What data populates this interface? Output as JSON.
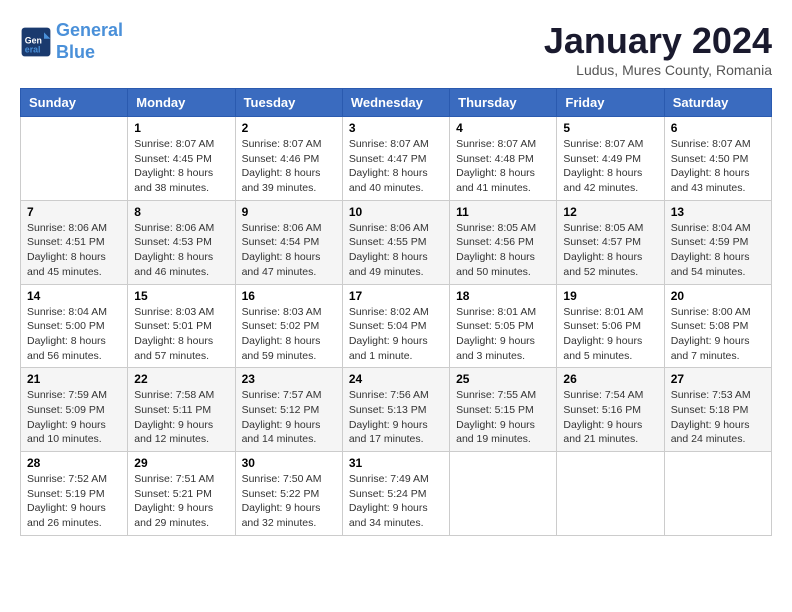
{
  "header": {
    "logo_line1": "General",
    "logo_line2": "Blue",
    "month_title": "January 2024",
    "subtitle": "Ludus, Mures County, Romania"
  },
  "days_of_week": [
    "Sunday",
    "Monday",
    "Tuesday",
    "Wednesday",
    "Thursday",
    "Friday",
    "Saturday"
  ],
  "weeks": [
    [
      {
        "day": "",
        "info": ""
      },
      {
        "day": "1",
        "info": "Sunrise: 8:07 AM\nSunset: 4:45 PM\nDaylight: 8 hours\nand 38 minutes."
      },
      {
        "day": "2",
        "info": "Sunrise: 8:07 AM\nSunset: 4:46 PM\nDaylight: 8 hours\nand 39 minutes."
      },
      {
        "day": "3",
        "info": "Sunrise: 8:07 AM\nSunset: 4:47 PM\nDaylight: 8 hours\nand 40 minutes."
      },
      {
        "day": "4",
        "info": "Sunrise: 8:07 AM\nSunset: 4:48 PM\nDaylight: 8 hours\nand 41 minutes."
      },
      {
        "day": "5",
        "info": "Sunrise: 8:07 AM\nSunset: 4:49 PM\nDaylight: 8 hours\nand 42 minutes."
      },
      {
        "day": "6",
        "info": "Sunrise: 8:07 AM\nSunset: 4:50 PM\nDaylight: 8 hours\nand 43 minutes."
      }
    ],
    [
      {
        "day": "7",
        "info": "Sunrise: 8:06 AM\nSunset: 4:51 PM\nDaylight: 8 hours\nand 45 minutes."
      },
      {
        "day": "8",
        "info": "Sunrise: 8:06 AM\nSunset: 4:53 PM\nDaylight: 8 hours\nand 46 minutes."
      },
      {
        "day": "9",
        "info": "Sunrise: 8:06 AM\nSunset: 4:54 PM\nDaylight: 8 hours\nand 47 minutes."
      },
      {
        "day": "10",
        "info": "Sunrise: 8:06 AM\nSunset: 4:55 PM\nDaylight: 8 hours\nand 49 minutes."
      },
      {
        "day": "11",
        "info": "Sunrise: 8:05 AM\nSunset: 4:56 PM\nDaylight: 8 hours\nand 50 minutes."
      },
      {
        "day": "12",
        "info": "Sunrise: 8:05 AM\nSunset: 4:57 PM\nDaylight: 8 hours\nand 52 minutes."
      },
      {
        "day": "13",
        "info": "Sunrise: 8:04 AM\nSunset: 4:59 PM\nDaylight: 8 hours\nand 54 minutes."
      }
    ],
    [
      {
        "day": "14",
        "info": "Sunrise: 8:04 AM\nSunset: 5:00 PM\nDaylight: 8 hours\nand 56 minutes."
      },
      {
        "day": "15",
        "info": "Sunrise: 8:03 AM\nSunset: 5:01 PM\nDaylight: 8 hours\nand 57 minutes."
      },
      {
        "day": "16",
        "info": "Sunrise: 8:03 AM\nSunset: 5:02 PM\nDaylight: 8 hours\nand 59 minutes."
      },
      {
        "day": "17",
        "info": "Sunrise: 8:02 AM\nSunset: 5:04 PM\nDaylight: 9 hours\nand 1 minute."
      },
      {
        "day": "18",
        "info": "Sunrise: 8:01 AM\nSunset: 5:05 PM\nDaylight: 9 hours\nand 3 minutes."
      },
      {
        "day": "19",
        "info": "Sunrise: 8:01 AM\nSunset: 5:06 PM\nDaylight: 9 hours\nand 5 minutes."
      },
      {
        "day": "20",
        "info": "Sunrise: 8:00 AM\nSunset: 5:08 PM\nDaylight: 9 hours\nand 7 minutes."
      }
    ],
    [
      {
        "day": "21",
        "info": "Sunrise: 7:59 AM\nSunset: 5:09 PM\nDaylight: 9 hours\nand 10 minutes."
      },
      {
        "day": "22",
        "info": "Sunrise: 7:58 AM\nSunset: 5:11 PM\nDaylight: 9 hours\nand 12 minutes."
      },
      {
        "day": "23",
        "info": "Sunrise: 7:57 AM\nSunset: 5:12 PM\nDaylight: 9 hours\nand 14 minutes."
      },
      {
        "day": "24",
        "info": "Sunrise: 7:56 AM\nSunset: 5:13 PM\nDaylight: 9 hours\nand 17 minutes."
      },
      {
        "day": "25",
        "info": "Sunrise: 7:55 AM\nSunset: 5:15 PM\nDaylight: 9 hours\nand 19 minutes."
      },
      {
        "day": "26",
        "info": "Sunrise: 7:54 AM\nSunset: 5:16 PM\nDaylight: 9 hours\nand 21 minutes."
      },
      {
        "day": "27",
        "info": "Sunrise: 7:53 AM\nSunset: 5:18 PM\nDaylight: 9 hours\nand 24 minutes."
      }
    ],
    [
      {
        "day": "28",
        "info": "Sunrise: 7:52 AM\nSunset: 5:19 PM\nDaylight: 9 hours\nand 26 minutes."
      },
      {
        "day": "29",
        "info": "Sunrise: 7:51 AM\nSunset: 5:21 PM\nDaylight: 9 hours\nand 29 minutes."
      },
      {
        "day": "30",
        "info": "Sunrise: 7:50 AM\nSunset: 5:22 PM\nDaylight: 9 hours\nand 32 minutes."
      },
      {
        "day": "31",
        "info": "Sunrise: 7:49 AM\nSunset: 5:24 PM\nDaylight: 9 hours\nand 34 minutes."
      },
      {
        "day": "",
        "info": ""
      },
      {
        "day": "",
        "info": ""
      },
      {
        "day": "",
        "info": ""
      }
    ]
  ]
}
